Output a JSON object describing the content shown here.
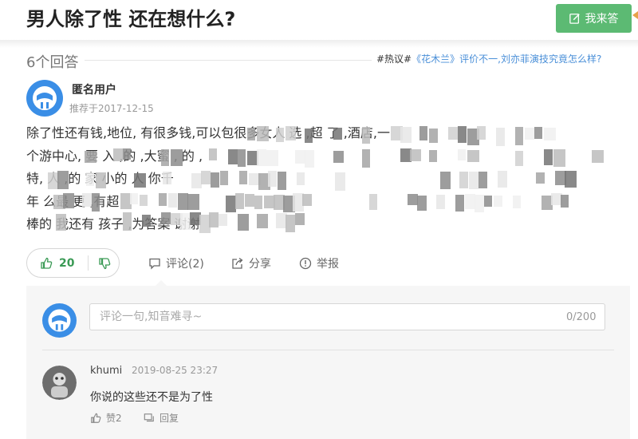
{
  "question": {
    "title": "男人除了性 还在想什么?",
    "answer_button": "我来答"
  },
  "answers": {
    "count_label": "6个回答"
  },
  "hot": {
    "tag": "#热议#",
    "topic": "《花木兰》评价不一,刘亦菲演技究竟怎么样?"
  },
  "answer": {
    "user": "匿名用户",
    "recommended": "推荐于2017-12-15",
    "lines": [
      "除了性还有钱,地位, 有很多钱,可以包很多女人 选 ,超 了 ,酒店,一",
      "个游中心, 要 入 ,的 ,大蜜 , 的 ,",
      "特, 人 ,的 家 小的 人 你千",
      "年 么最 更 ,有超",
      "棒的 我还有 孩子 ,为答案 谢谢"
    ]
  },
  "actions": {
    "upvotes": "20",
    "comment": "评论(2)",
    "share": "分享",
    "report": "举报"
  },
  "comment_box": {
    "placeholder": "评论一句,知音难寻~",
    "counter": "0/200"
  },
  "comments": [
    {
      "user": "khumi",
      "time": "2019-08-25 23:27",
      "text": "你说的这些还不是为了性",
      "like": "赞2",
      "reply": "回复"
    }
  ],
  "colors": {
    "accent_green": "#5cba73",
    "link_blue": "#4a8fd8",
    "avatar_blue": "#3a8ee6"
  }
}
